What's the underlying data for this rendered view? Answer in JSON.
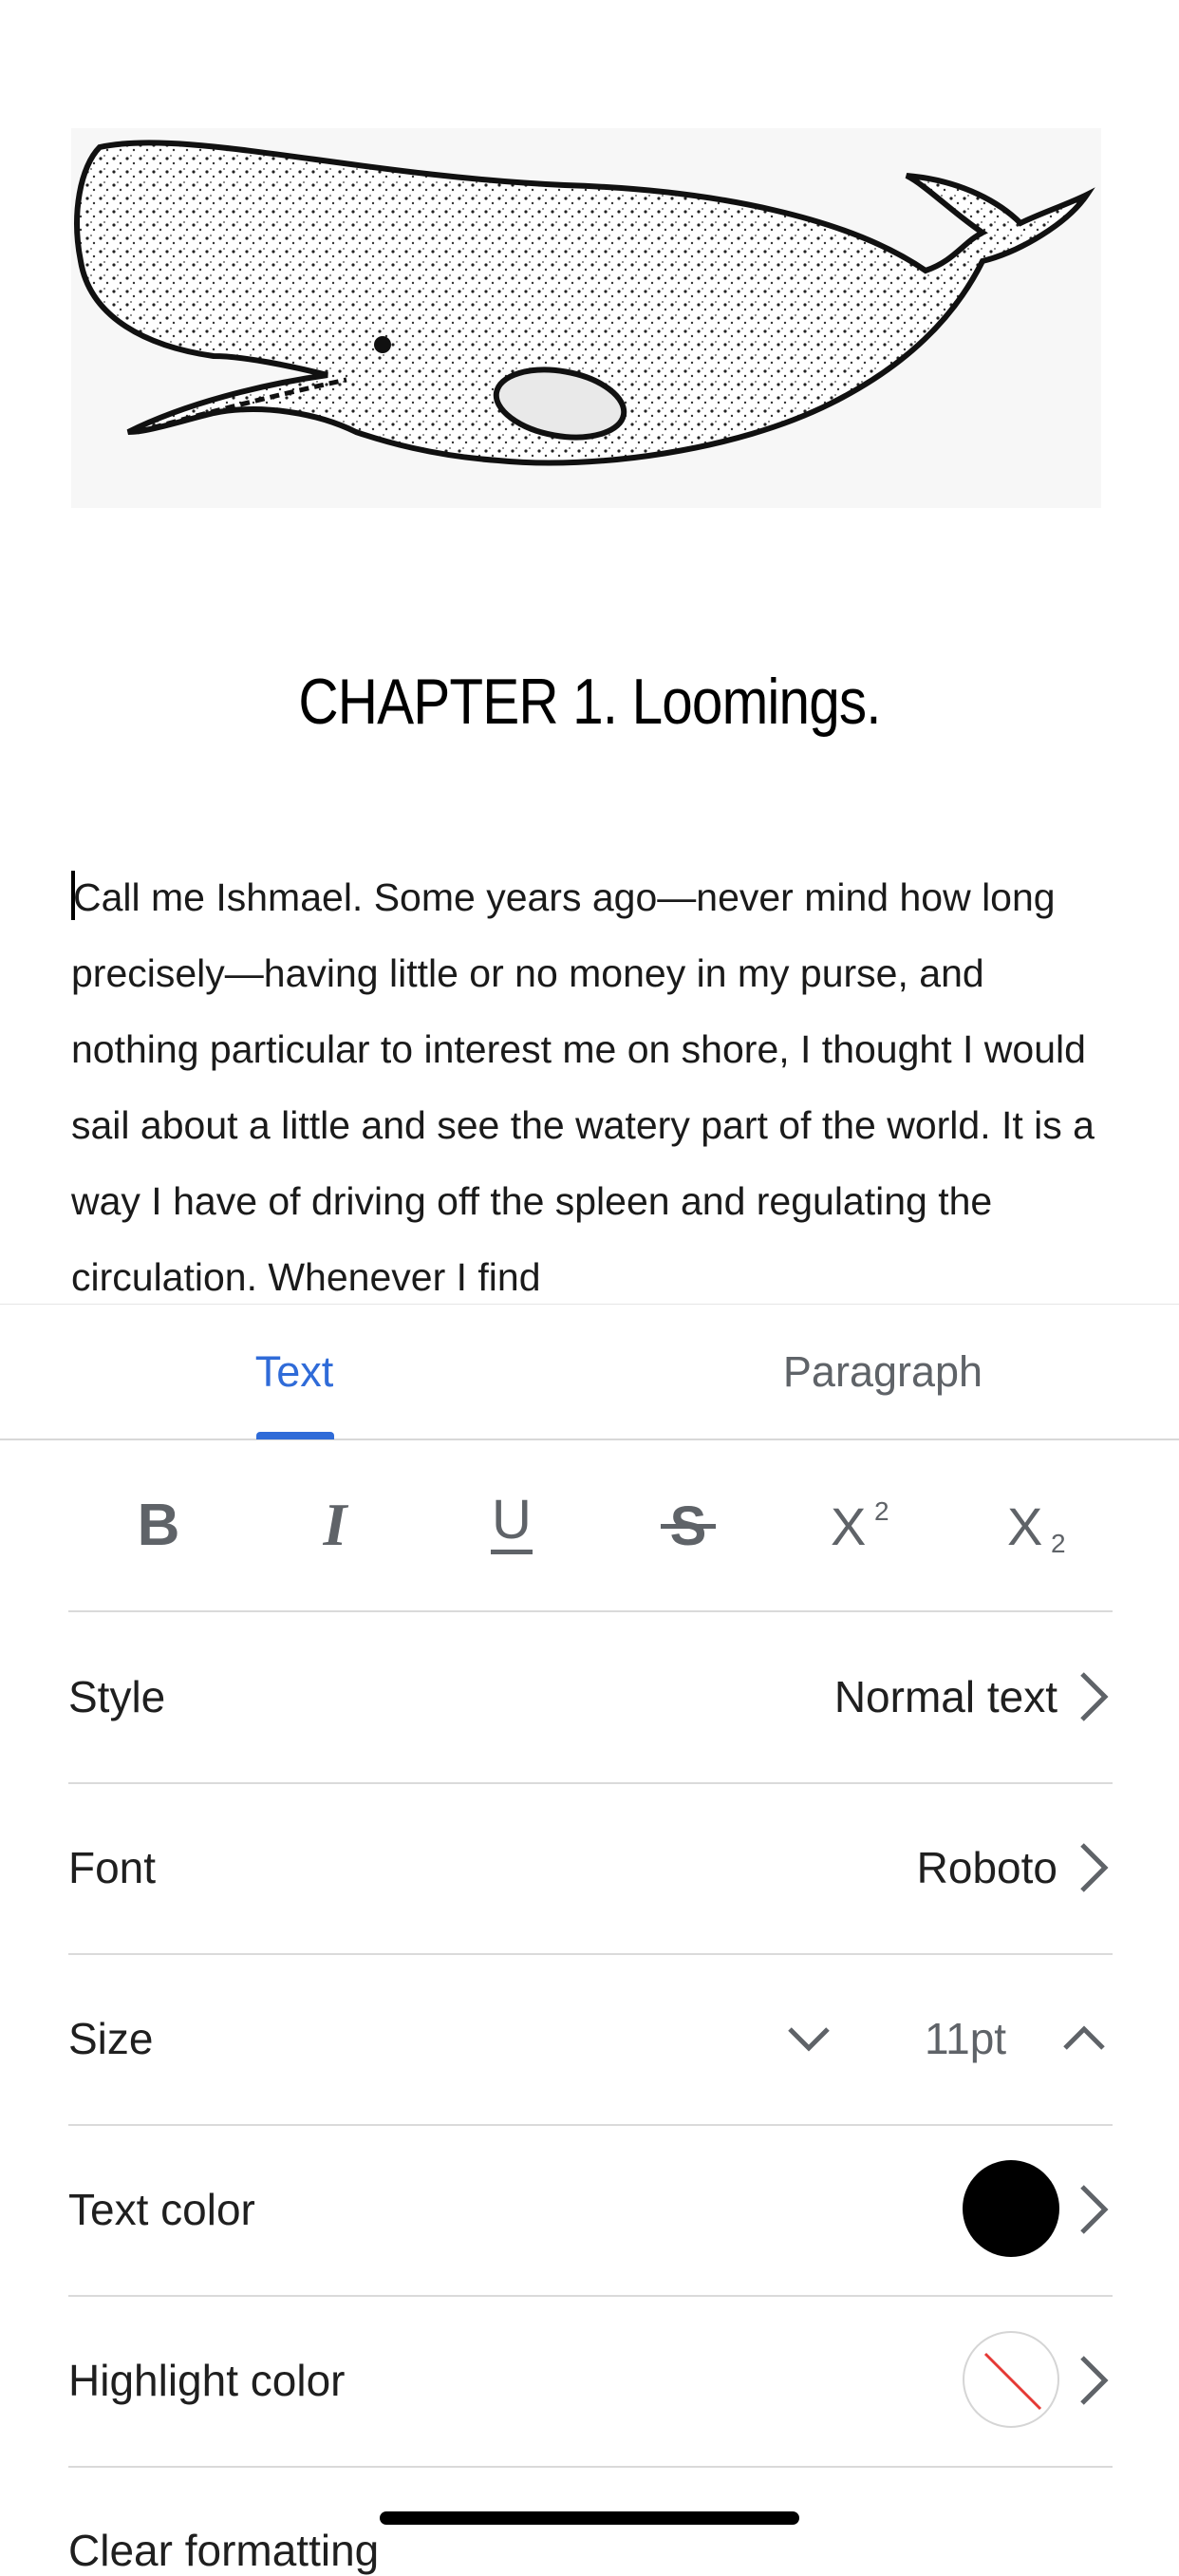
{
  "document": {
    "chapter_title": "CHAPTER 1. Loomings.",
    "body": "Call me Ishmael. Some years ago—never mind how long precisely—having little or no money in my purse, and nothing particular to interest me on shore, I thought I would sail about a little and see the watery part of the world. It is a way I have of driving off the spleen and regulating the circulation. Whenever I find"
  },
  "tabs": [
    {
      "label": "Text",
      "active": true
    },
    {
      "label": "Paragraph",
      "active": false
    }
  ],
  "format_buttons": [
    "bold-icon",
    "italic-icon",
    "underline-icon",
    "strikethrough-icon",
    "superscript-icon",
    "subscript-icon"
  ],
  "rows": {
    "style": {
      "label": "Style",
      "value": "Normal text"
    },
    "font": {
      "label": "Font",
      "value": "Roboto"
    },
    "size": {
      "label": "Size",
      "value": "11pt"
    },
    "text_color": {
      "label": "Text color",
      "color": "#000000"
    },
    "highlight_color": {
      "label": "Highlight color",
      "color": "none"
    }
  },
  "clear_formatting": "Clear formatting",
  "colors": {
    "accent": "#2f6bd8"
  }
}
